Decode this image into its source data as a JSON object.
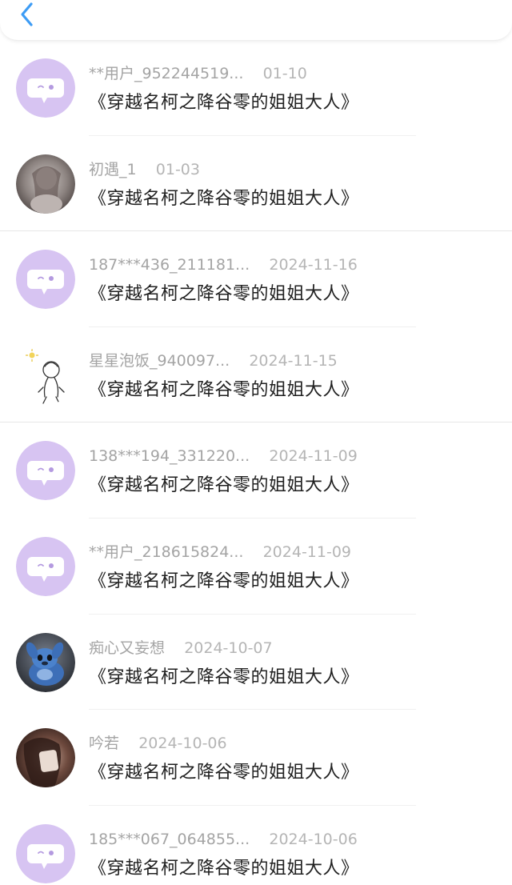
{
  "header": {
    "back_icon": "chevron-left-icon",
    "accent_color": "#3d9cf5"
  },
  "colors": {
    "default_avatar_bg": "#d7c4f2",
    "username_text": "#a4a4a4",
    "title_text": "#202020"
  },
  "list": [
    {
      "username": "**用户_952244519...",
      "date": "01-10",
      "title": "《穿越名柯之降谷零的姐姐大人》",
      "avatar": "default-chat-avatar"
    },
    {
      "username": "初遇_1",
      "date": "01-03",
      "title": "《穿越名柯之降谷零的姐姐大人》",
      "avatar": "anime-girl-avatar"
    },
    {
      "username": "187***436_211181...",
      "date": "2024-11-16",
      "title": "《穿越名柯之降谷零的姐姐大人》",
      "avatar": "default-chat-avatar"
    },
    {
      "username": "星星泡饭_940097...",
      "date": "2024-11-15",
      "title": "《穿越名柯之降谷零的姐姐大人》",
      "avatar": "sketch-doodle-avatar"
    },
    {
      "username": "138***194_331220...",
      "date": "2024-11-09",
      "title": "《穿越名柯之降谷零的姐姐大人》",
      "avatar": "default-chat-avatar"
    },
    {
      "username": "**用户_218615824...",
      "date": "2024-11-09",
      "title": "《穿越名柯之降谷零的姐姐大人》",
      "avatar": "default-chat-avatar"
    },
    {
      "username": "痴心又妄想",
      "date": "2024-10-07",
      "title": "《穿越名柯之降谷零的姐姐大人》",
      "avatar": "blue-plush-avatar"
    },
    {
      "username": "吟若",
      "date": "2024-10-06",
      "title": "《穿越名柯之降谷零的姐姐大人》",
      "avatar": "dark-photo-avatar"
    },
    {
      "username": "185***067_064855...",
      "date": "2024-10-06",
      "title": "《穿越名柯之降谷零的姐姐大人》",
      "avatar": "default-chat-avatar"
    }
  ]
}
